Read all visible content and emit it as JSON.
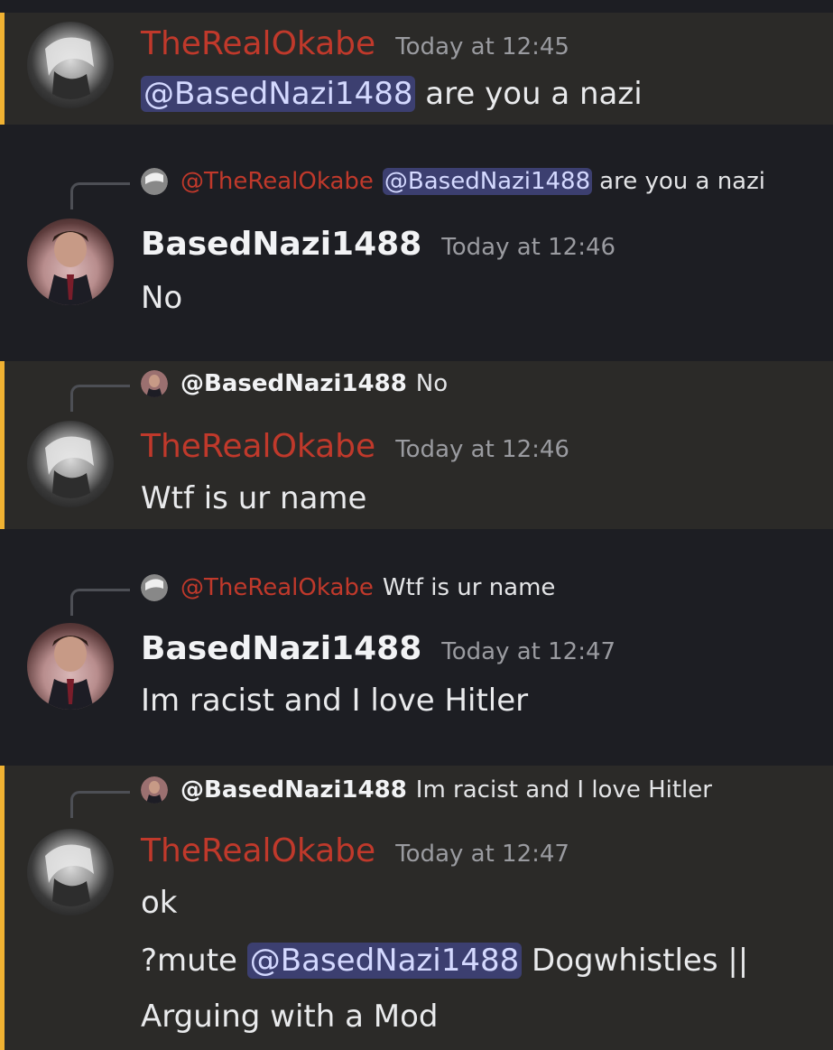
{
  "colors": {
    "highlight_bar": "#f0b232",
    "highlight_bg": "#2b2a28",
    "plain_bg": "#1d1e23",
    "okabe_name": "#c0392b",
    "mention_bg": "#3c3f70",
    "mention_text": "#d4d9ff"
  },
  "messages": [
    {
      "author": "TheRealOkabe",
      "timestamp": "Today at 12:45",
      "mention": "@BasedNazi1488",
      "text": " are you a nazi"
    },
    {
      "reply": {
        "author": "@TheRealOkabe",
        "mention": "@BasedNazi1488",
        "text": "are you a nazi"
      },
      "author": "BasedNazi1488",
      "timestamp": "Today at 12:46",
      "text": "No"
    },
    {
      "reply": {
        "author": "@BasedNazi1488",
        "text": "No"
      },
      "author": "TheRealOkabe",
      "timestamp": "Today at 12:46",
      "text": "Wtf is ur name"
    },
    {
      "reply": {
        "author": "@TheRealOkabe",
        "text": "Wtf is ur name"
      },
      "author": "BasedNazi1488",
      "timestamp": "Today at 12:47",
      "text": "Im racist and I love Hitler"
    },
    {
      "reply": {
        "author": "@BasedNazi1488",
        "text": "Im racist and I love Hitler"
      },
      "author": "TheRealOkabe",
      "timestamp": "Today at 12:47",
      "line1": "ok",
      "line2_prefix": "?mute ",
      "line2_mention": "@BasedNazi1488",
      "line2_suffix": " Dogwhistles ||",
      "line3": "Arguing with a Mod"
    }
  ]
}
